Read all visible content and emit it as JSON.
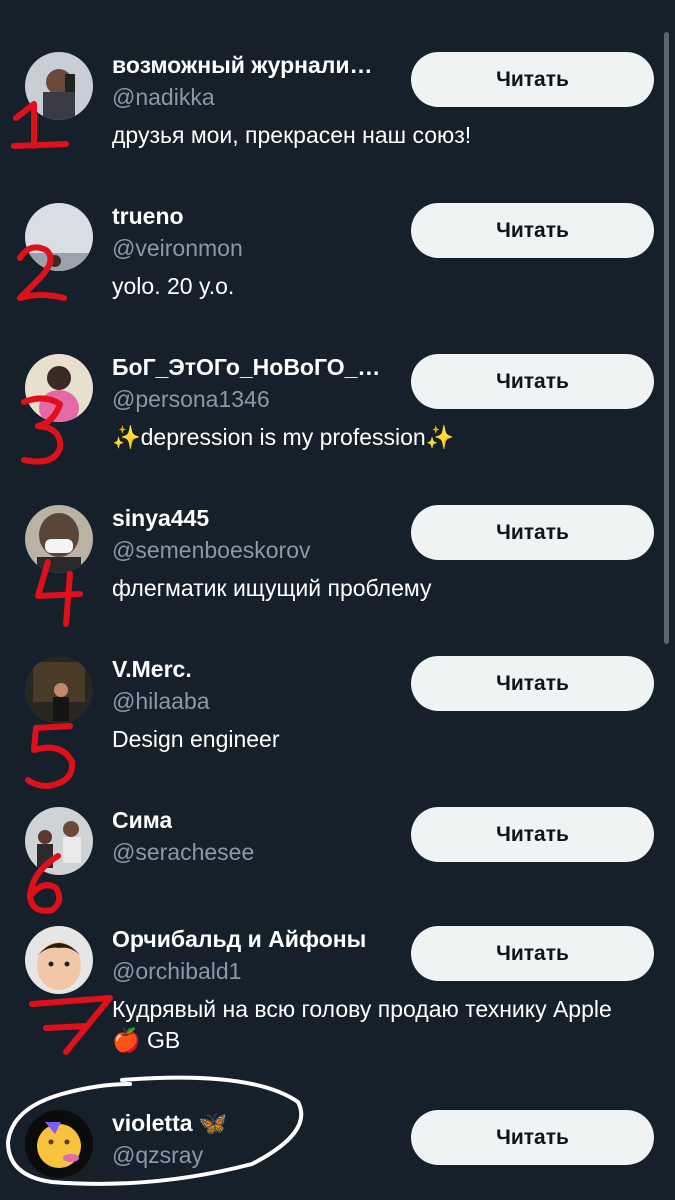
{
  "follow_label": "Читать",
  "accounts": [
    {
      "name": "возможный журнали…",
      "handle": "@nadikka",
      "bio": "друзья мои, прекрасен наш союз!"
    },
    {
      "name": "trueno",
      "handle": "@veironmon",
      "bio": "yolo. 20 y.o."
    },
    {
      "name": "БоГ_ЭтОГо_НоВоГО_…",
      "handle": "@persona1346",
      "bio": "✨depression is my profession✨"
    },
    {
      "name": "sinya445",
      "handle": "@semenboeskorov",
      "bio": "флегматик ищущий проблему"
    },
    {
      "name": "V.Merc.",
      "handle": "@hilaaba",
      "bio": "Design engineer"
    },
    {
      "name": "Сима",
      "handle": "@serachesee",
      "bio": ""
    },
    {
      "name": "Орчибальд и Айфоны",
      "handle": "@orchibald1",
      "bio": "Кудрявый на всю голову продаю технику Apple 🍎 GB"
    },
    {
      "name": "violetta 🦋",
      "handle": "@qzsray",
      "bio": ""
    }
  ],
  "colors": {
    "background": "#15202b",
    "annotation": "#e0101a",
    "button": "#eff3f4"
  }
}
